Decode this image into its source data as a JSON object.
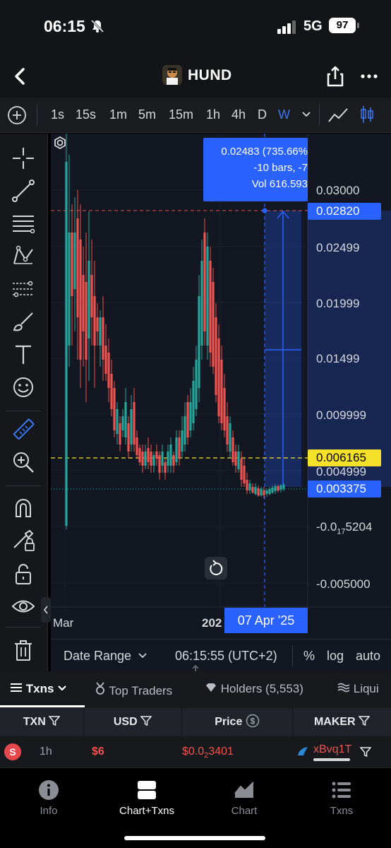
{
  "status_bar": {
    "time": "06:15",
    "network": "5G",
    "battery": "97"
  },
  "header": {
    "title": "HUND"
  },
  "timeframes": [
    "1s",
    "15s",
    "1m",
    "5m",
    "15m",
    "1h",
    "4h",
    "D",
    "W"
  ],
  "active_timeframe": "W",
  "chart": {
    "price_labels": [
      "0.03000",
      "0.02499",
      "0.01999",
      "0.01499",
      "0.009999",
      "0.004999",
      "-0.005000"
    ],
    "price_label_small": {
      "prefix": "-0.0",
      "sub": "17",
      "suffix": "5204"
    },
    "tag_measure_top": "0.02820",
    "tag_yellow": "0.006165",
    "tag_current": "0.003375",
    "measure_line1": "0.02483 (735.66%",
    "measure_line2": "-10 bars, -7",
    "measure_line3": "Vol 616.593",
    "x_label_left": "Mar",
    "x_label_mid": "202",
    "x_tag": "07 Apr '25"
  },
  "chart_bar": {
    "date_range": "Date Range",
    "clock": "06:15:55 (UTC+2)",
    "percent": "%",
    "log": "log",
    "auto": "auto"
  },
  "tabs": {
    "txns": "Txns",
    "top_traders": "Top Traders",
    "holders": "Holders (5,553)",
    "liquidity": "Liqui"
  },
  "table": {
    "headers": {
      "txn": "TXN",
      "usd": "USD",
      "price": "Price",
      "maker": "MAKER"
    },
    "row": {
      "type": "S",
      "age": "1h",
      "usd": "$6",
      "price_prefix": "$0.0",
      "price_sub": "2",
      "price_suffix": "3401",
      "maker": "xBvq1T"
    }
  },
  "tabbar": {
    "info": "Info",
    "chart_txns": "Chart+Txns",
    "chart": "Chart",
    "txns": "Txns"
  },
  "colors": {
    "accent_blue": "#2962ff",
    "up": "#26a69a",
    "down": "#ef5350",
    "yellow": "#f5e12a"
  }
}
